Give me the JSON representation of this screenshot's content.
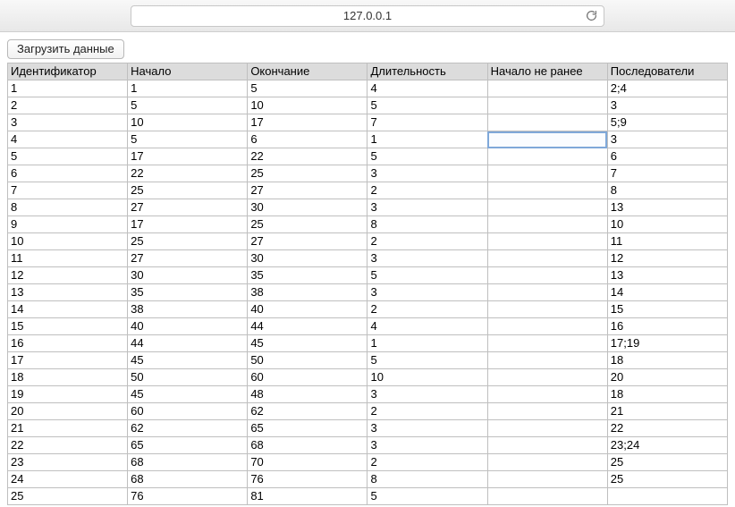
{
  "browser": {
    "address": "127.0.0.1"
  },
  "button": {
    "load_label": "Загрузить данные"
  },
  "columns": [
    "Идентификатор",
    "Начало",
    "Окончание",
    "Длительность",
    "Начало не ранее",
    "Последователи"
  ],
  "rows": [
    {
      "id": "1",
      "start": "1",
      "end": "5",
      "dur": "4",
      "nlt": "",
      "succ": "2;4"
    },
    {
      "id": "2",
      "start": "5",
      "end": "10",
      "dur": "5",
      "nlt": "",
      "succ": "3"
    },
    {
      "id": "3",
      "start": "10",
      "end": "17",
      "dur": "7",
      "nlt": "",
      "succ": "5;9"
    },
    {
      "id": "4",
      "start": "5",
      "end": "6",
      "dur": "1",
      "nlt": "",
      "succ": "3"
    },
    {
      "id": "5",
      "start": "17",
      "end": "22",
      "dur": "5",
      "nlt": "",
      "succ": "6"
    },
    {
      "id": "6",
      "start": "22",
      "end": "25",
      "dur": "3",
      "nlt": "",
      "succ": "7"
    },
    {
      "id": "7",
      "start": "25",
      "end": "27",
      "dur": "2",
      "nlt": "",
      "succ": "8"
    },
    {
      "id": "8",
      "start": "27",
      "end": "30",
      "dur": "3",
      "nlt": "",
      "succ": "13"
    },
    {
      "id": "9",
      "start": "17",
      "end": "25",
      "dur": "8",
      "nlt": "",
      "succ": "10"
    },
    {
      "id": "10",
      "start": "25",
      "end": "27",
      "dur": "2",
      "nlt": "",
      "succ": "11"
    },
    {
      "id": "11",
      "start": "27",
      "end": "30",
      "dur": "3",
      "nlt": "",
      "succ": "12"
    },
    {
      "id": "12",
      "start": "30",
      "end": "35",
      "dur": "5",
      "nlt": "",
      "succ": "13"
    },
    {
      "id": "13",
      "start": "35",
      "end": "38",
      "dur": "3",
      "nlt": "",
      "succ": "14"
    },
    {
      "id": "14",
      "start": "38",
      "end": "40",
      "dur": "2",
      "nlt": "",
      "succ": "15"
    },
    {
      "id": "15",
      "start": "40",
      "end": "44",
      "dur": "4",
      "nlt": "",
      "succ": "16"
    },
    {
      "id": "16",
      "start": "44",
      "end": "45",
      "dur": "1",
      "nlt": "",
      "succ": "17;19"
    },
    {
      "id": "17",
      "start": "45",
      "end": "50",
      "dur": "5",
      "nlt": "",
      "succ": "18"
    },
    {
      "id": "18",
      "start": "50",
      "end": "60",
      "dur": "10",
      "nlt": "",
      "succ": "20"
    },
    {
      "id": "19",
      "start": "45",
      "end": "48",
      "dur": "3",
      "nlt": "",
      "succ": "18"
    },
    {
      "id": "20",
      "start": "60",
      "end": "62",
      "dur": "2",
      "nlt": "",
      "succ": "21"
    },
    {
      "id": "21",
      "start": "62",
      "end": "65",
      "dur": "3",
      "nlt": "",
      "succ": "22"
    },
    {
      "id": "22",
      "start": "65",
      "end": "68",
      "dur": "3",
      "nlt": "",
      "succ": "23;24"
    },
    {
      "id": "23",
      "start": "68",
      "end": "70",
      "dur": "2",
      "nlt": "",
      "succ": "25"
    },
    {
      "id": "24",
      "start": "68",
      "end": "76",
      "dur": "8",
      "nlt": "",
      "succ": "25"
    },
    {
      "id": "25",
      "start": "76",
      "end": "81",
      "dur": "5",
      "nlt": "",
      "succ": ""
    }
  ],
  "active_cell": {
    "row_index": 3,
    "col_key": "nlt"
  }
}
